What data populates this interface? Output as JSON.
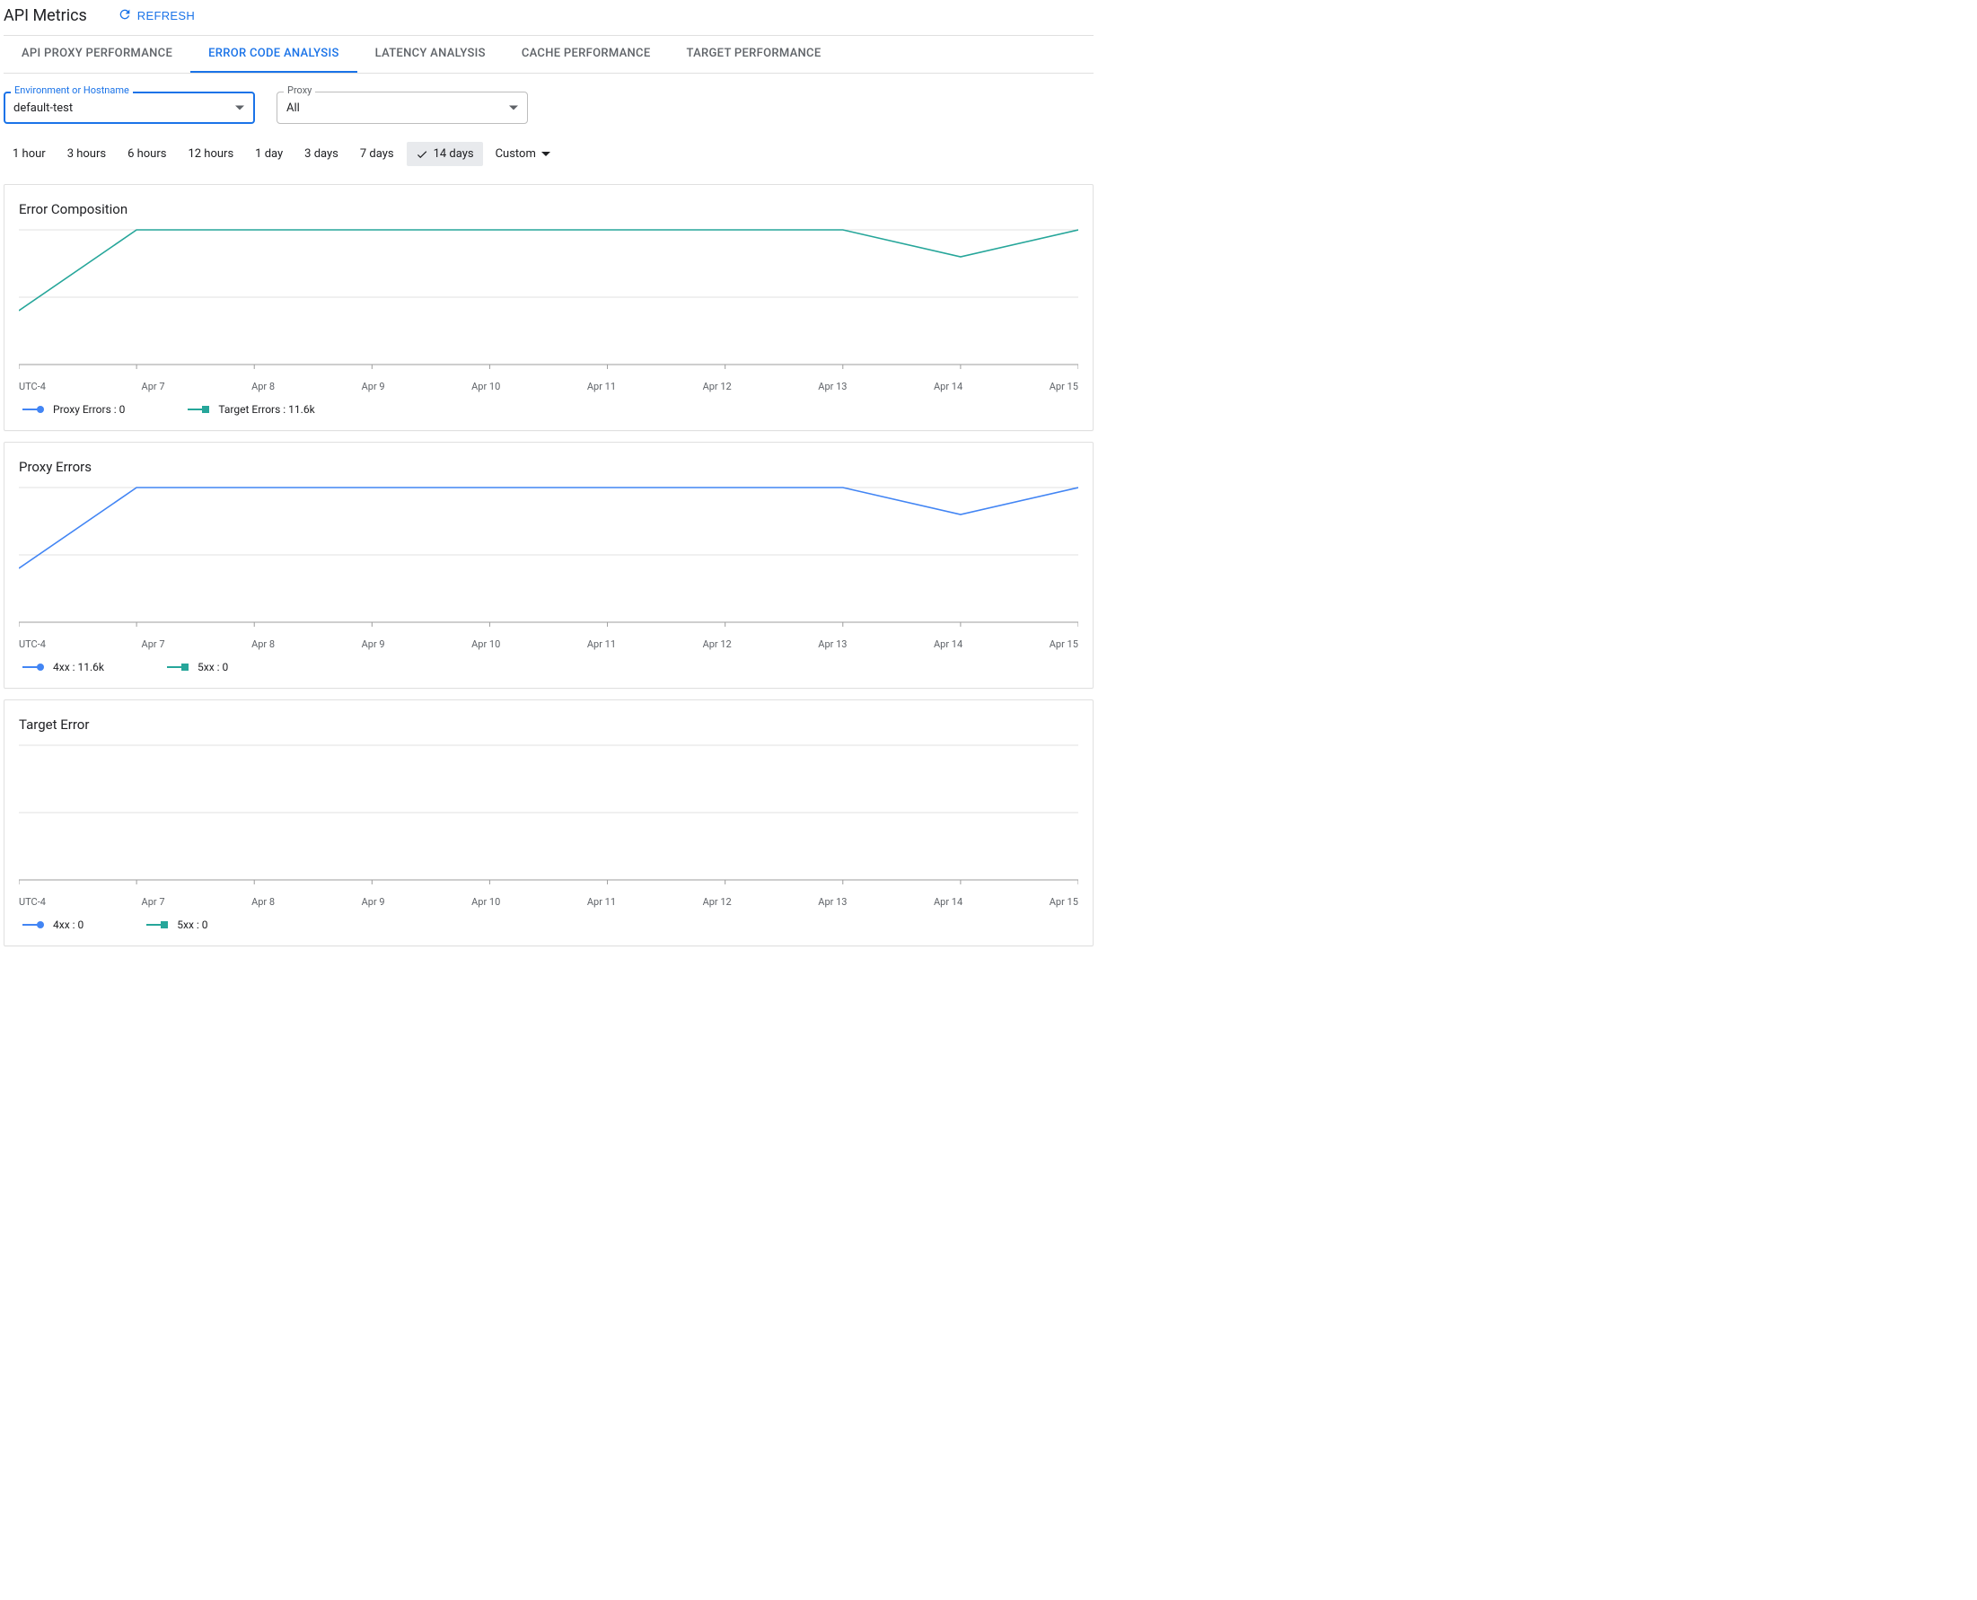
{
  "page": {
    "title": "API Metrics",
    "refresh_label": "REFRESH"
  },
  "tabs": [
    {
      "label": "API PROXY PERFORMANCE",
      "active": false
    },
    {
      "label": "ERROR CODE ANALYSIS",
      "active": true
    },
    {
      "label": "LATENCY ANALYSIS",
      "active": false
    },
    {
      "label": "CACHE PERFORMANCE",
      "active": false
    },
    {
      "label": "TARGET PERFORMANCE",
      "active": false
    }
  ],
  "filters": {
    "environment": {
      "label": "Environment or Hostname",
      "value": "default-test"
    },
    "proxy": {
      "label": "Proxy",
      "value": "All"
    }
  },
  "ranges": {
    "items": [
      "1 hour",
      "3 hours",
      "6 hours",
      "12 hours",
      "1 day",
      "3 days",
      "7 days",
      "14 days",
      "Custom"
    ],
    "selected": "14 days"
  },
  "axis_ticks": [
    "UTC-4",
    "Apr 7",
    "Apr 8",
    "Apr 9",
    "Apr 10",
    "Apr 11",
    "Apr 12",
    "Apr 13",
    "Apr 14",
    "Apr 15"
  ],
  "chart_data": [
    {
      "id": "error_composition",
      "type": "line",
      "title": "Error Composition",
      "x": [
        "UTC-4",
        "Apr 7",
        "Apr 8",
        "Apr 9",
        "Apr 10",
        "Apr 11",
        "Apr 12",
        "Apr 13",
        "Apr 14",
        "Apr 15"
      ],
      "series": [
        {
          "name": "Proxy Errors",
          "display": "Proxy Errors :  0",
          "color": "#4285f4",
          "marker": "circle",
          "values": [
            0,
            0,
            0,
            0,
            0,
            0,
            0,
            0,
            0,
            0
          ]
        },
        {
          "name": "Target Errors",
          "display": "Target Errors :  11.6k",
          "color": "#26a69a",
          "marker": "square",
          "norm_values": [
            0.4,
            1.0,
            1.0,
            1.0,
            1.0,
            1.0,
            1.0,
            1.0,
            0.8,
            1.0
          ]
        }
      ],
      "xlabel": "",
      "ylabel": ""
    },
    {
      "id": "proxy_errors",
      "type": "line",
      "title": "Proxy Errors",
      "x": [
        "UTC-4",
        "Apr 7",
        "Apr 8",
        "Apr 9",
        "Apr 10",
        "Apr 11",
        "Apr 12",
        "Apr 13",
        "Apr 14",
        "Apr 15"
      ],
      "series": [
        {
          "name": "4xx",
          "display": "4xx :  11.6k",
          "color": "#4285f4",
          "marker": "circle",
          "norm_values": [
            0.4,
            1.0,
            1.0,
            1.0,
            1.0,
            1.0,
            1.0,
            1.0,
            0.8,
            1.0
          ]
        },
        {
          "name": "5xx",
          "display": "5xx :  0",
          "color": "#26a69a",
          "marker": "square",
          "values": [
            0,
            0,
            0,
            0,
            0,
            0,
            0,
            0,
            0,
            0
          ]
        }
      ],
      "xlabel": "",
      "ylabel": ""
    },
    {
      "id": "target_error",
      "type": "line",
      "title": "Target Error",
      "x": [
        "UTC-4",
        "Apr 7",
        "Apr 8",
        "Apr 9",
        "Apr 10",
        "Apr 11",
        "Apr 12",
        "Apr 13",
        "Apr 14",
        "Apr 15"
      ],
      "series": [
        {
          "name": "4xx",
          "display": "4xx :  0",
          "color": "#4285f4",
          "marker": "circle",
          "values": [
            0,
            0,
            0,
            0,
            0,
            0,
            0,
            0,
            0,
            0
          ]
        },
        {
          "name": "5xx",
          "display": "5xx :  0",
          "color": "#26a69a",
          "marker": "square",
          "values": [
            0,
            0,
            0,
            0,
            0,
            0,
            0,
            0,
            0,
            0
          ]
        }
      ],
      "xlabel": "",
      "ylabel": ""
    }
  ]
}
